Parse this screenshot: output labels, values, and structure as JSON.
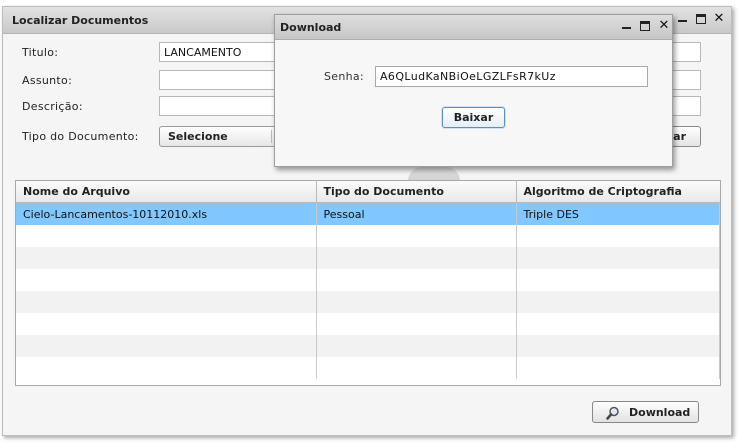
{
  "main_window": {
    "title": "Localizar Documentos",
    "form": {
      "titulo_label": "Titulo:",
      "titulo_value": "LANCAMENTO",
      "assunto_label": "Assunto:",
      "assunto_value": "",
      "descricao_label": "Descrição:",
      "descricao_value": "",
      "tipo_label": "Tipo do Documento:",
      "tipo_selected": "Selecione",
      "search_button_partial": "ar"
    },
    "grid": {
      "columns": [
        "Nome do Arquivo",
        "Tipo do Documento",
        "Algoritmo de Criptografia"
      ],
      "rows": [
        {
          "nome": "Cielo-Lancamentos-10112010.xls",
          "tipo": "Pessoal",
          "algoritmo": "Triple DES"
        }
      ]
    },
    "download_button": "Download",
    "download_icon": "magnifier-icon"
  },
  "dialog": {
    "title": "Download",
    "senha_label": "Senha:",
    "senha_value": "A6QLudKaNBiOeLGZLFsR7kUz",
    "baixar_button": "Baixar"
  },
  "colors": {
    "selected_row": "#80c8ff",
    "title_bar": "#d2d2d2"
  }
}
